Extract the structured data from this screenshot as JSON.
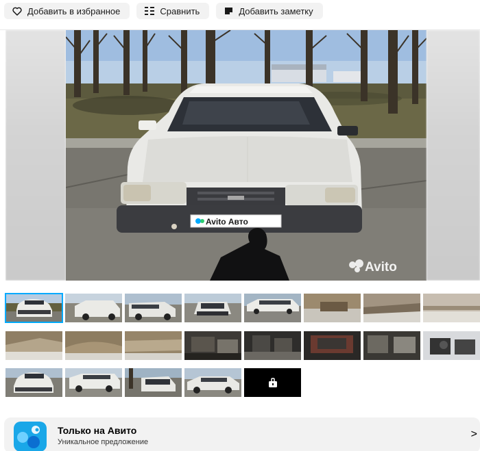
{
  "toolbar": {
    "favorite_label": "Добавить в избранное",
    "compare_label": "Сравнить",
    "note_label": "Добавить заметку"
  },
  "gallery": {
    "main_photo_alt": "",
    "watermark": "Avito",
    "plate_text": "Avito Авто",
    "thumbnails_count": 21,
    "selected_index": 0
  },
  "promo": {
    "title": "Только на Авито",
    "subtitle": "Уникальное предложение",
    "chevron": ">"
  },
  "colors": {
    "accent": "#00aaff",
    "button_bg": "#f2f2f2",
    "promo_bg": "#f2f2f2"
  }
}
